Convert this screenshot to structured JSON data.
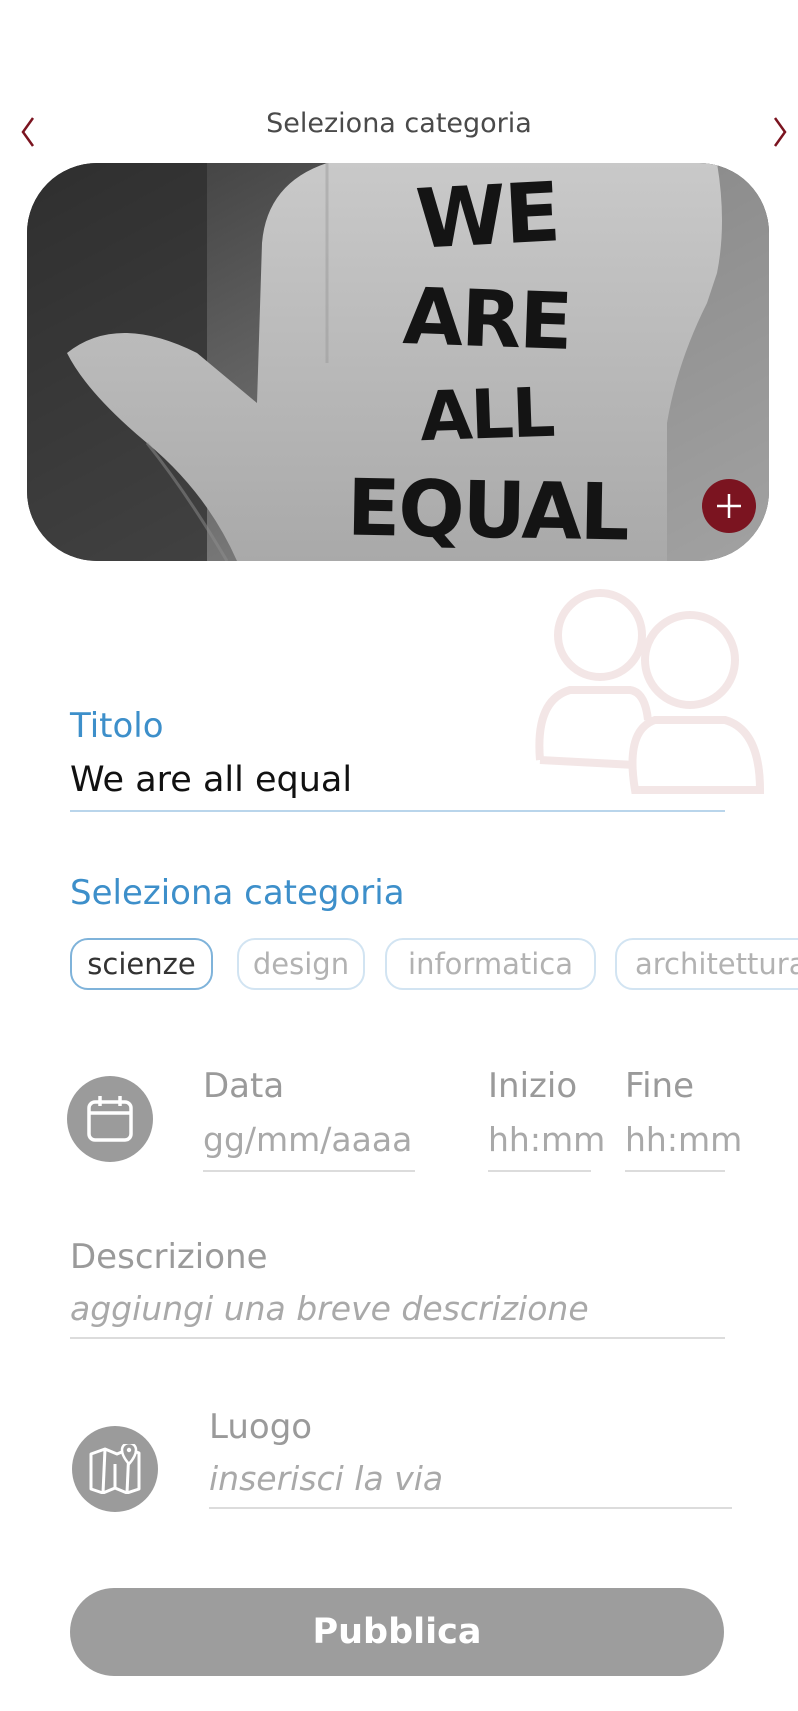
{
  "header": {
    "title": "Seleziona categoria"
  },
  "image": {
    "handwritten_text": [
      "WE",
      "ARE",
      "ALL",
      "EQUAL"
    ]
  },
  "form": {
    "title": {
      "label": "Titolo",
      "value": "We are all equal"
    },
    "category": {
      "label": "Seleziona categoria",
      "chips": [
        {
          "label": "scienze",
          "selected": true
        },
        {
          "label": "design",
          "selected": false
        },
        {
          "label": "informatica",
          "selected": false
        },
        {
          "label": "architettura",
          "selected": false
        }
      ]
    },
    "date": {
      "label": "Data",
      "placeholder": "gg/mm/aaaa"
    },
    "start": {
      "label": "Inizio",
      "placeholder": "hh:mm"
    },
    "end": {
      "label": "Fine",
      "placeholder": "hh:mm"
    },
    "description": {
      "label": "Descrizione",
      "placeholder": "aggiungi una breve descrizione"
    },
    "location": {
      "label": "Luogo",
      "placeholder": "inserisci la via"
    }
  },
  "actions": {
    "publish_label": "Pubblica"
  },
  "colors": {
    "accent_blue": "#3d8fca",
    "brand_red": "#7b1420",
    "button_gray": "#9d9d9d"
  },
  "icons": [
    "chevron-left-icon",
    "chevron-right-icon",
    "plus-icon",
    "people-icon",
    "calendar-icon",
    "map-icon"
  ]
}
